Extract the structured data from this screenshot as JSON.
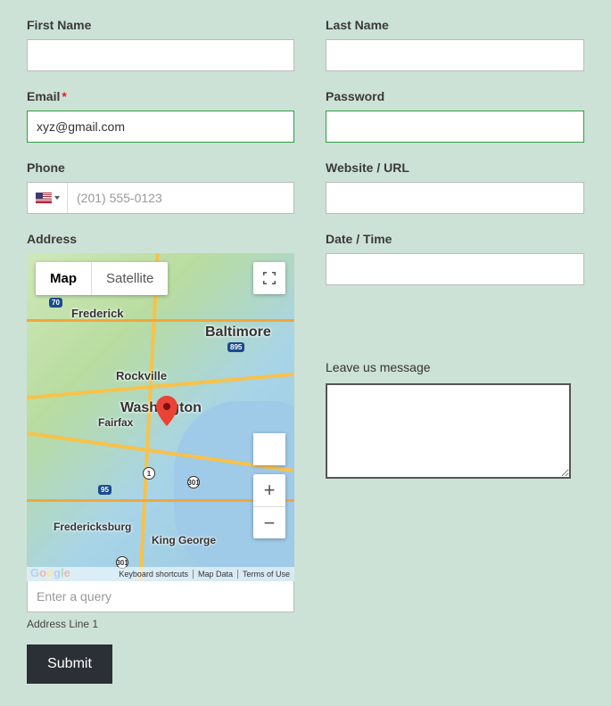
{
  "labels": {
    "first_name": "First Name",
    "last_name": "Last Name",
    "email": "Email",
    "password": "Password",
    "phone": "Phone",
    "website": "Website / URL",
    "address": "Address",
    "datetime": "Date / Time",
    "message": "Leave us message",
    "address_line1": "Address Line 1"
  },
  "values": {
    "first_name": "",
    "last_name": "",
    "email": "xyz@gmail.com",
    "password": "",
    "phone": "",
    "website": "",
    "datetime": "",
    "address_query": "",
    "message": ""
  },
  "placeholders": {
    "phone": "(201) 555-0123",
    "address_query": "Enter a query"
  },
  "map": {
    "type_map": "Map",
    "type_satellite": "Satellite",
    "footer_shortcuts": "Keyboard shortcuts",
    "footer_mapdata": "Map Data",
    "footer_terms": "Terms of Use",
    "zoom_in": "+",
    "zoom_out": "−",
    "cities": {
      "baltimore": "Baltimore",
      "washington": "Washington",
      "frederick": "Frederick",
      "rockville": "Rockville",
      "fairfax": "Fairfax",
      "fredericksburg": "Fredericksburg",
      "king_george": "King George"
    },
    "highways": {
      "i70": "70",
      "i95": "95",
      "i895": "895",
      "us1": "1",
      "us301a": "301",
      "us301b": "301"
    }
  },
  "buttons": {
    "submit": "Submit"
  },
  "required_marker": "*"
}
